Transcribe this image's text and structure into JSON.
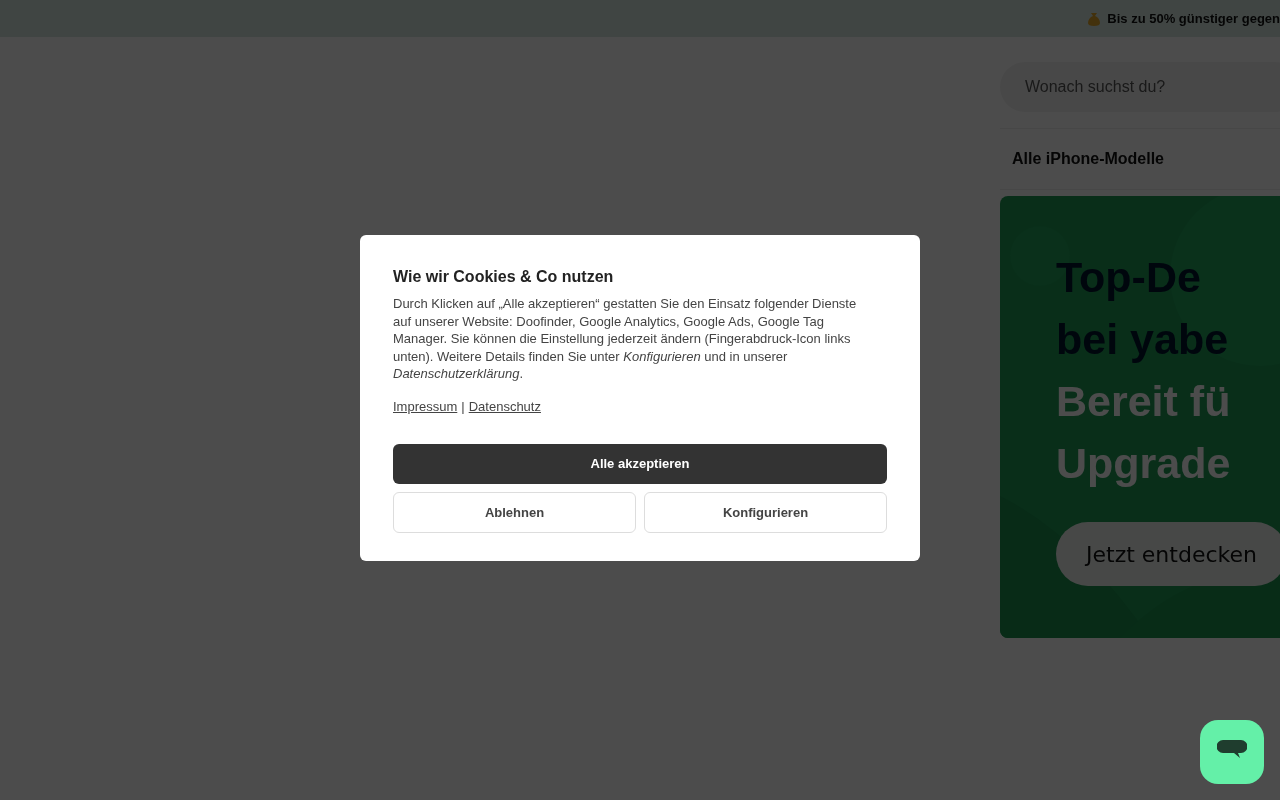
{
  "promo_bar": {
    "text": "Bis zu 50% günstiger gegen"
  },
  "search": {
    "placeholder": "Wonach suchst du?"
  },
  "nav_link": "Alle iPhone-Modelle",
  "banner": {
    "kind": "picture",
    "lines": [
      {
        "text": "Top-De",
        "kind": "dark"
      },
      {
        "text": "bei yabe",
        "kind": "dark"
      },
      {
        "text": "Bereit fü",
        "kind": "light"
      },
      {
        "text": "Upgrade",
        "kind": "light"
      }
    ],
    "button": "Jetzt entdecken"
  },
  "cookie_dialog": {
    "title": "Wie wir Cookies & Co nutzen",
    "body": "Durch Klicken auf „Alle akzeptieren“ gestatten Sie den Einsatz folgender Dienste auf unserer Website: Doofinder, Google Analytics, Google Ads, Google Tag Manager. Sie können die Einstellung jederzeit ändern (Fingerabdruck-Icon links unten). Weitere Details finden Sie unter *Konfigurieren* und in unserer *Datenschutzerklärung*.",
    "links": [
      "Impressum",
      "Datenschutz"
    ],
    "separator": "|",
    "buttons": [
      {
        "label": "Alle akzeptieren",
        "kind": "primary"
      },
      {
        "label": "Ablehnen",
        "kind": "secondary"
      },
      {
        "label": "Konfigurieren",
        "kind": "secondary"
      }
    ]
  }
}
